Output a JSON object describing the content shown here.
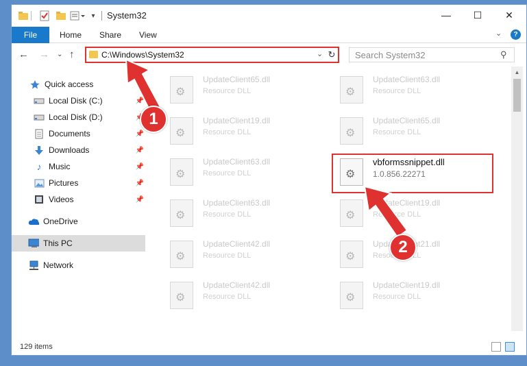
{
  "window": {
    "title": "System32",
    "controls": {
      "minimize": "—",
      "maximize": "☐",
      "close": "✕"
    }
  },
  "ribbon": {
    "file": "File",
    "tabs": [
      "Home",
      "Share",
      "View"
    ]
  },
  "address": {
    "path": "C:\\Windows\\System32",
    "search_placeholder": "Search System32"
  },
  "nav": {
    "items": [
      {
        "label": "Quick access",
        "icon": "star-icon"
      },
      {
        "label": "Local Disk (C:)",
        "icon": "drive-icon",
        "pinned": true
      },
      {
        "label": "Local Disk (D:)",
        "icon": "drive-icon",
        "pinned": true
      },
      {
        "label": "Documents",
        "icon": "documents-icon",
        "pinned": true
      },
      {
        "label": "Downloads",
        "icon": "download-icon",
        "pinned": true
      },
      {
        "label": "Music",
        "icon": "music-icon",
        "pinned": true
      },
      {
        "label": "Pictures",
        "icon": "pictures-icon",
        "pinned": true
      },
      {
        "label": "Videos",
        "icon": "videos-icon",
        "pinned": true
      },
      {
        "label": "OneDrive",
        "icon": "cloud-icon"
      },
      {
        "label": "This PC",
        "icon": "computer-icon",
        "selected": true
      },
      {
        "label": "Network",
        "icon": "network-icon"
      }
    ]
  },
  "files": [
    {
      "name": "UpdateClient65.dll",
      "sub": "Resource DLL"
    },
    {
      "name": "UpdateClient63.dll",
      "sub": "Resource DLL"
    },
    {
      "name": "UpdateClient19.dll",
      "sub": "Resource DLL"
    },
    {
      "name": "UpdateClient65.dll",
      "sub": "Resource DLL"
    },
    {
      "name": "UpdateClient63.dll",
      "sub": "Resource DLL"
    },
    {
      "name": "vbformssnippet.dll",
      "sub": "1.0.856.22271",
      "highlighted": true
    },
    {
      "name": "UpdateClient63.dll",
      "sub": "Resource DLL"
    },
    {
      "name": "UpdateClient19.dll",
      "sub": "Resource DLL"
    },
    {
      "name": "UpdateClient42.dll",
      "sub": "Resource DLL"
    },
    {
      "name": "UpdateClient21.dll",
      "sub": "Resource DLL"
    },
    {
      "name": "UpdateClient42.dll",
      "sub": "Resource DLL"
    },
    {
      "name": "UpdateClient19.dll",
      "sub": "Resource DLL"
    }
  ],
  "status": {
    "count": "129 items"
  },
  "annotations": {
    "step1": "1",
    "step2": "2"
  },
  "colors": {
    "accent": "#1979ca",
    "highlight": "#e03131"
  }
}
